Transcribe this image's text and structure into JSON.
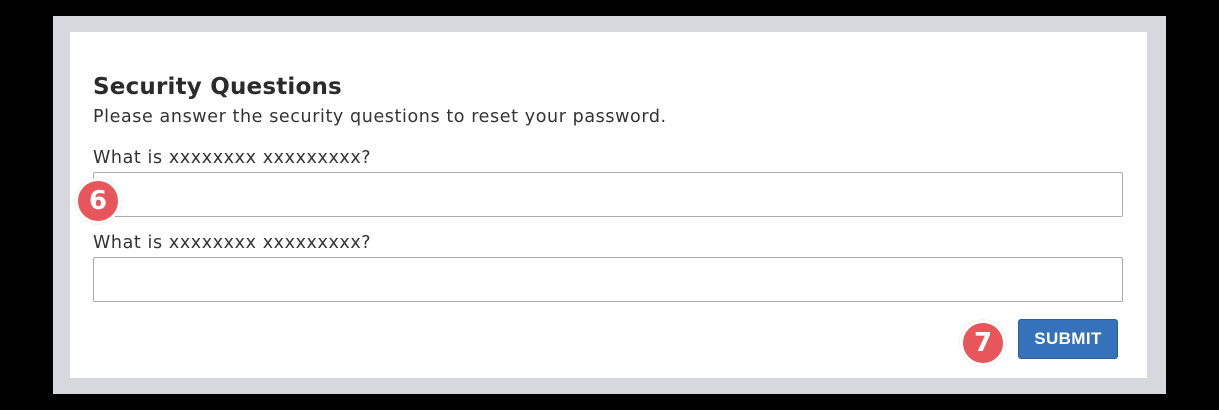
{
  "form": {
    "title": "Security Questions",
    "subtitle": "Please answer the security questions to reset your password.",
    "questions": [
      {
        "label": "What is xxxxxxxx xxxxxxxxx?",
        "value": "",
        "placeholder": ""
      },
      {
        "label": "What is xxxxxxxx xxxxxxxxx?",
        "value": "",
        "placeholder": ""
      }
    ],
    "submit_label": "SUBMIT"
  },
  "annotations": {
    "badges": [
      "6",
      "7"
    ]
  },
  "colors": {
    "page_background": "#000000",
    "frame_background": "#d7d8dd",
    "panel_background": "#ffffff",
    "button_primary": "#3672b9",
    "badge": "#e8555b"
  }
}
